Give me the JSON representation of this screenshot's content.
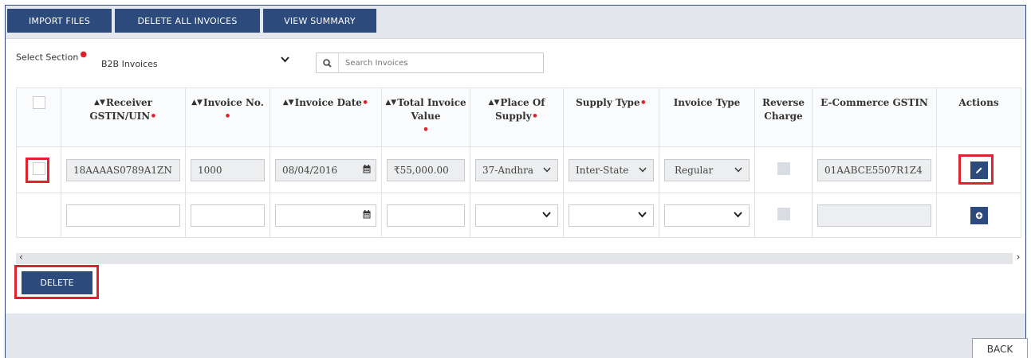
{
  "toolbar": {
    "import_label": "IMPORT FILES",
    "delete_all_label": "DELETE ALL INVOICES",
    "view_summary_label": "VIEW SUMMARY"
  },
  "section": {
    "label": "Select Section",
    "selected": "B2B Invoices"
  },
  "search": {
    "placeholder": "Search Invoices"
  },
  "columns": {
    "receiver": "Receiver GSTIN/UIN",
    "invoice_no": "Invoice No.",
    "invoice_date": "Invoice Date",
    "total_value": "Total Invoice Value",
    "place_of_supply": "Place Of Supply",
    "supply_type": "Supply Type",
    "invoice_type": "Invoice Type",
    "reverse_charge": "Reverse Charge",
    "ecommerce_gstin": "E-Commerce GSTIN",
    "actions": "Actions"
  },
  "row1": {
    "receiver": "18AAAAS0789A1ZN",
    "invoice_no": "1000",
    "invoice_date": "08/04/2016",
    "total_value": "₹55,000.00",
    "place_of_supply": "37-Andhra",
    "supply_type": "Inter-State",
    "invoice_type": "Regular",
    "ecommerce_gstin": "01AABCE5507R1Z4"
  },
  "delete_label": "DELETE",
  "back_label": "BACK",
  "colors": {
    "primary": "#2c4a7c",
    "highlight": "#e0222f",
    "toolbar_bg": "#e4e8ee"
  }
}
